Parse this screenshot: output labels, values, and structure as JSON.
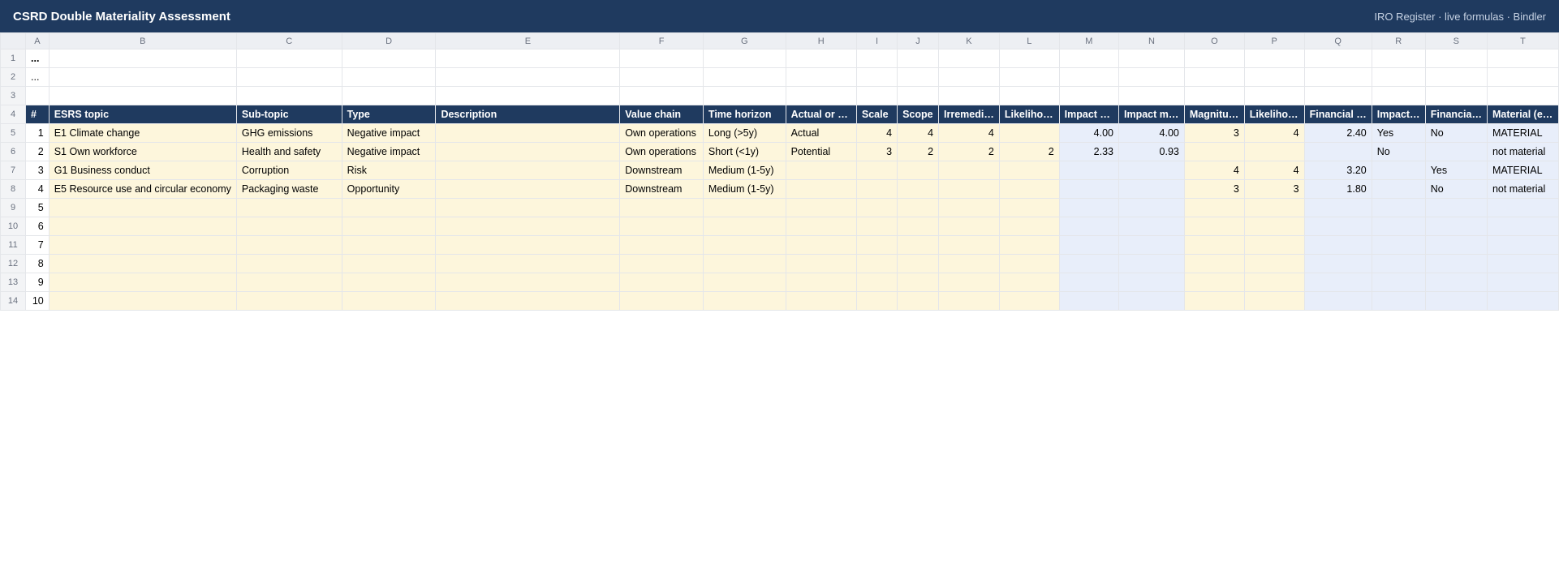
{
  "app": {
    "title": "CSRD Double Materiality Assessment",
    "meta": "IRO Register · live formulas · Bindler"
  },
  "columns": [
    "A",
    "B",
    "C",
    "D",
    "E",
    "F",
    "G",
    "H",
    "I",
    "J",
    "K",
    "L",
    "M",
    "N",
    "O",
    "P",
    "Q",
    "R",
    "S",
    "T"
  ],
  "row_numbers": [
    "1",
    "2",
    "3",
    "4",
    "5",
    "6",
    "7",
    "8",
    "9",
    "10",
    "11",
    "12",
    "13",
    "14"
  ],
  "top_rows": {
    "r1": "...",
    "r2": "..."
  },
  "header": [
    "#",
    "ESRS topic",
    "Sub-topic",
    "Type",
    "Description",
    "Value chain",
    "Time horizon",
    "Actual or potential",
    "Scale",
    "Scope",
    "Irremediability",
    "Likelihood",
    "Impact severity",
    "Impact materiality",
    "Magnitude",
    "Likelihood",
    "Financial materiality",
    "Impact material",
    "Financial material",
    "Material (either)"
  ],
  "header_display": [
    "#",
    "ESRS topic",
    "Sub-topic",
    "Type",
    "Description",
    "Value chain",
    "Time horizon",
    "Actual or …",
    "Scale",
    "Scope",
    "Irremedi…",
    "Likeliho…",
    "Impact …",
    "Impact m…",
    "Magnitu…",
    "Likeliho…",
    "Financial …",
    "Impact…",
    "Financia…",
    "Material (e…"
  ],
  "rows": [
    [
      "1",
      "E1 Climate change",
      "GHG emissions",
      "Negative impact",
      "",
      "Own operations",
      "Long (>5y)",
      "Actual",
      "4",
      "4",
      "4",
      "",
      "4.00",
      "4.00",
      "3",
      "4",
      "2.40",
      "Yes",
      "No",
      "MATERIAL"
    ],
    [
      "2",
      "S1 Own workforce",
      "Health and safety",
      "Negative impact",
      "",
      "Own operations",
      "Short (<1y)",
      "Potential",
      "3",
      "2",
      "2",
      "2",
      "2.33",
      "0.93",
      "",
      "",
      "",
      "No",
      "",
      "not material"
    ],
    [
      "3",
      "G1 Business conduct",
      "Corruption",
      "Risk",
      "",
      "Downstream",
      "Medium (1-5y)",
      "",
      "",
      "",
      "",
      "",
      "",
      "",
      "4",
      "4",
      "3.20",
      "",
      "Yes",
      "MATERIAL"
    ],
    [
      "4",
      "E5 Resource use and circular economy",
      "Packaging waste",
      "Opportunity",
      "",
      "Downstream",
      "Medium (1-5y)",
      "",
      "",
      "",
      "",
      "",
      "",
      "",
      "3",
      "3",
      "1.80",
      "",
      "No",
      "not material"
    ],
    [
      "5",
      "",
      "",
      "",
      "",
      "",
      "",
      "",
      "",
      "",
      "",
      "",
      "",
      "",
      "",
      "",
      "",
      "",
      "",
      ""
    ],
    [
      "6",
      "",
      "",
      "",
      "",
      "",
      "",
      "",
      "",
      "",
      "",
      "",
      "",
      "",
      "",
      "",
      "",
      "",
      "",
      ""
    ],
    [
      "7",
      "",
      "",
      "",
      "",
      "",
      "",
      "",
      "",
      "",
      "",
      "",
      "",
      "",
      "",
      "",
      "",
      "",
      "",
      ""
    ],
    [
      "8",
      "",
      "",
      "",
      "",
      "",
      "",
      "",
      "",
      "",
      "",
      "",
      "",
      "",
      "",
      "",
      "",
      "",
      "",
      ""
    ],
    [
      "9",
      "",
      "",
      "",
      "",
      "",
      "",
      "",
      "",
      "",
      "",
      "",
      "",
      "",
      "",
      "",
      "",
      "",
      "",
      ""
    ],
    [
      "10",
      "",
      "",
      "",
      "",
      "",
      "",
      "",
      "",
      "",
      "",
      "",
      "",
      "",
      "",
      "",
      "",
      "",
      "",
      ""
    ]
  ],
  "colors": {
    "header_bg": "#1f3a5f",
    "input_bg": "#fdf6dc",
    "calc_bg": "#e8eefa"
  }
}
